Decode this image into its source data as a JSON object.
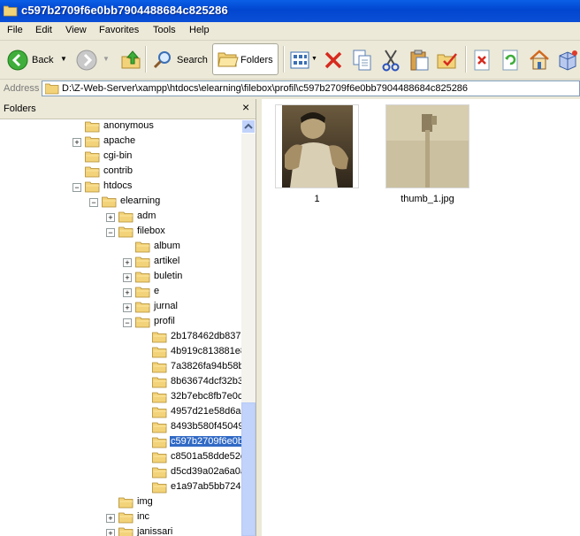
{
  "window": {
    "title": "c597b2709f6e0bb7904488684c825286"
  },
  "menu": [
    "File",
    "Edit",
    "View",
    "Favorites",
    "Tools",
    "Help"
  ],
  "toolbar": {
    "back_label": "Back",
    "search_label": "Search",
    "folders_label": "Folders"
  },
  "address": {
    "label": "Address",
    "value": "D:\\Z-Web-Server\\xampp\\htdocs\\elearning\\filebox\\profil\\c597b2709f6e0bb7904488684c825286"
  },
  "folders_pane": {
    "title": "Folders",
    "close": "×",
    "tree": [
      {
        "label": "anonymous",
        "expander": ""
      },
      {
        "label": "apache",
        "expander": "+"
      },
      {
        "label": "cgi-bin",
        "expander": ""
      },
      {
        "label": "contrib",
        "expander": ""
      },
      {
        "label": "htdocs",
        "expander": "−"
      },
      {
        "label": "elearning",
        "expander": "−"
      },
      {
        "label": "adm",
        "expander": "+"
      },
      {
        "label": "filebox",
        "expander": "−"
      },
      {
        "label": "album",
        "expander": ""
      },
      {
        "label": "artikel",
        "expander": "+"
      },
      {
        "label": "buletin",
        "expander": "+"
      },
      {
        "label": "e",
        "expander": "+"
      },
      {
        "label": "jurnal",
        "expander": "+"
      },
      {
        "label": "profil",
        "expander": "−"
      },
      {
        "label": "2b178462db837",
        "expander": ""
      },
      {
        "label": "4b919c813881e8",
        "expander": ""
      },
      {
        "label": "7a3826fa94b58b",
        "expander": ""
      },
      {
        "label": "8b63674dcf32b3",
        "expander": ""
      },
      {
        "label": "32b7ebc8fb7e0c",
        "expander": ""
      },
      {
        "label": "4957d21e58d6a",
        "expander": ""
      },
      {
        "label": "8493b580f45049",
        "expander": ""
      },
      {
        "label": "c597b2709f6e0b",
        "expander": "",
        "selected": true
      },
      {
        "label": "c8501a58dde52c",
        "expander": ""
      },
      {
        "label": "d5cd39a02a6a0a",
        "expander": ""
      },
      {
        "label": "e1a97ab5bb724",
        "expander": ""
      },
      {
        "label": "img",
        "expander": ""
      },
      {
        "label": "inc",
        "expander": "+"
      },
      {
        "label": "janissari",
        "expander": "+"
      }
    ]
  },
  "files": [
    {
      "name": "1"
    },
    {
      "name": "thumb_1.jpg"
    }
  ],
  "colors": {
    "selection": "#316ac5",
    "titlebar": "#0a5fe6"
  }
}
